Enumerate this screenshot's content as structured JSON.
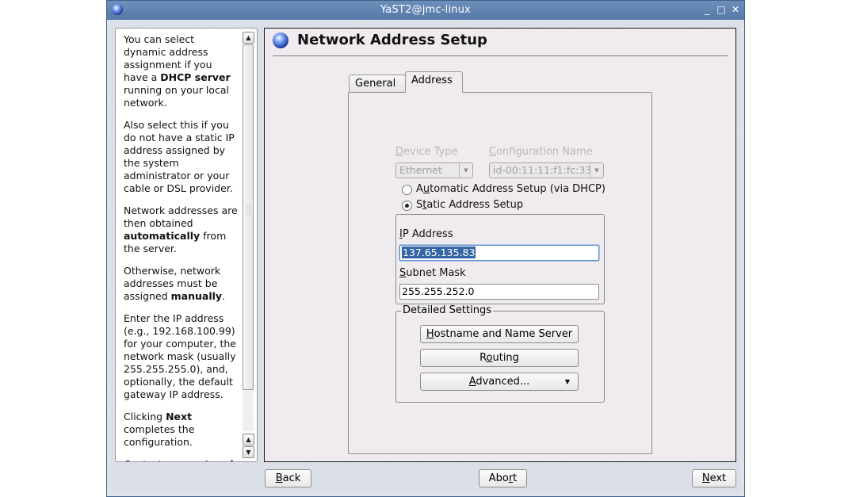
{
  "window": {
    "title": "YaST2@jmc-linux",
    "controls": {
      "minimize": "_",
      "maximize": "□",
      "close": "✕"
    }
  },
  "help": {
    "paragraphs": [
      [
        {
          "t": "You can select dynamic address assignment if you have a "
        },
        {
          "t": "DHCP server",
          "b": true
        },
        {
          "t": " running on your local network."
        }
      ],
      [
        {
          "t": "Also select this if you do not have a static IP address assigned by the system administrator or your cable or DSL provider."
        }
      ],
      [
        {
          "t": "Network addresses are then obtained "
        },
        {
          "t": "automatically",
          "b": true
        },
        {
          "t": " from the server."
        }
      ],
      [
        {
          "t": "Otherwise, network addresses must be assigned "
        },
        {
          "t": "manually",
          "b": true
        },
        {
          "t": "."
        }
      ],
      [
        {
          "t": "Enter the IP address (e.g., 192.168.100.99) for your computer, the network mask (usually 255.255.255.0), and, optionally, the default gateway IP address."
        }
      ],
      [
        {
          "t": "Clicking "
        },
        {
          "t": "Next",
          "b": true
        },
        {
          "t": " completes the configuration."
        }
      ],
      [
        {
          "t": "Contact your "
        },
        {
          "t": "network",
          "b": true
        }
      ]
    ]
  },
  "main": {
    "title": "Network Address Setup",
    "tabs": [
      {
        "label": "General",
        "active": false
      },
      {
        "label": "Address",
        "active": true
      }
    ],
    "device_type": {
      "label": "Device Type",
      "value": "Ethernet",
      "enabled": false
    },
    "config_name": {
      "label": "Configuration Name",
      "value": "id-00:11:11:f1:fc:33",
      "enabled": false
    },
    "radio_dhcp": {
      "label": "Automatic Address Setup (via DHCP)",
      "selected": false
    },
    "radio_static": {
      "label": "Static Address Setup",
      "selected": true
    },
    "ip_address": {
      "label": "IP Address",
      "value": "137.65.135.83"
    },
    "subnet_mask": {
      "label": "Subnet Mask",
      "value": "255.255.252.0"
    },
    "detailed_settings": {
      "legend": "Detailed Settings",
      "hostname_button": "Hostname and Name Server",
      "routing_button": "Routing",
      "advanced_button": "Advanced..."
    }
  },
  "footer": {
    "back": "Back",
    "abort": "Abort",
    "next": "Next"
  }
}
